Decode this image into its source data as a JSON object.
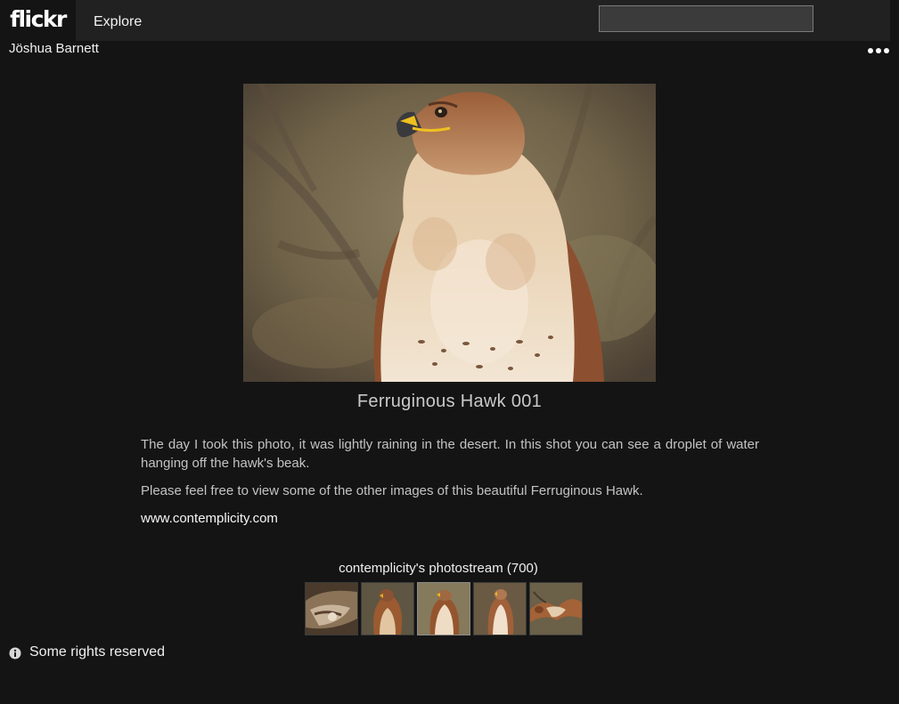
{
  "header": {
    "logo": "flickr",
    "nav_explore": "Explore",
    "search_value": ""
  },
  "owner": {
    "name": "Jöshua Barnett"
  },
  "photo": {
    "title": "Ferruginous Hawk 001",
    "description": [
      "The day I took this photo, it was lightly raining in the desert. In this shot you can see a droplet of water hanging off the hawk's beak.",
      "Please feel free to view some of the other images of this beautiful Ferruginous Hawk."
    ],
    "link": "www.contemplicity.com"
  },
  "photostream": {
    "label": "contemplicity's photostream (700)",
    "thumbnails_count": 5,
    "current_index": 2
  },
  "license": {
    "label": "Some rights reserved"
  },
  "colors": {
    "background": "#141414",
    "topbar": "#212121"
  }
}
